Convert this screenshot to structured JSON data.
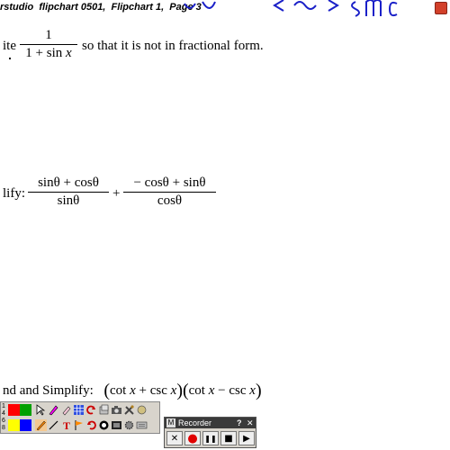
{
  "window": {
    "title": "rstudio  flipchart 0501,  Flipchart 1,  Page 3"
  },
  "problem1": {
    "lead": "ite",
    "numerator": "1",
    "denominator_prefix": "1 + sin ",
    "denominator_var": "x",
    "trail": "so that it is not in fractional form."
  },
  "problem2": {
    "lead": "lify:",
    "frac1_num": "sinθ + cosθ",
    "frac1_den": "sinθ",
    "plus": "+",
    "frac2_num": "− cosθ + sinθ",
    "frac2_den": "cosθ"
  },
  "problem3": {
    "lead": "nd and Simplify:",
    "open1": "(",
    "cot1": "cot ",
    "x1": "x",
    "plus": " + csc ",
    "x2": "x",
    "closeopen": ")(",
    "cot2": "cot ",
    "x3": "x",
    "minus": " − csc ",
    "x4": "x",
    "close2": ")"
  },
  "toolbar": {
    "palette_numbers": [
      "1",
      "4",
      "6",
      "8"
    ],
    "colors": [
      "#ff0000",
      "#00a000",
      "#ffff00",
      "#0000ff",
      "#800000",
      "#ff8800"
    ]
  },
  "recorder": {
    "icon": "M",
    "title": "Recorder",
    "help": "?",
    "close": "✕",
    "buttons": {
      "cancel": "✕",
      "record": "●",
      "pause": "❚❚",
      "stop": "■",
      "play": "▶"
    }
  }
}
